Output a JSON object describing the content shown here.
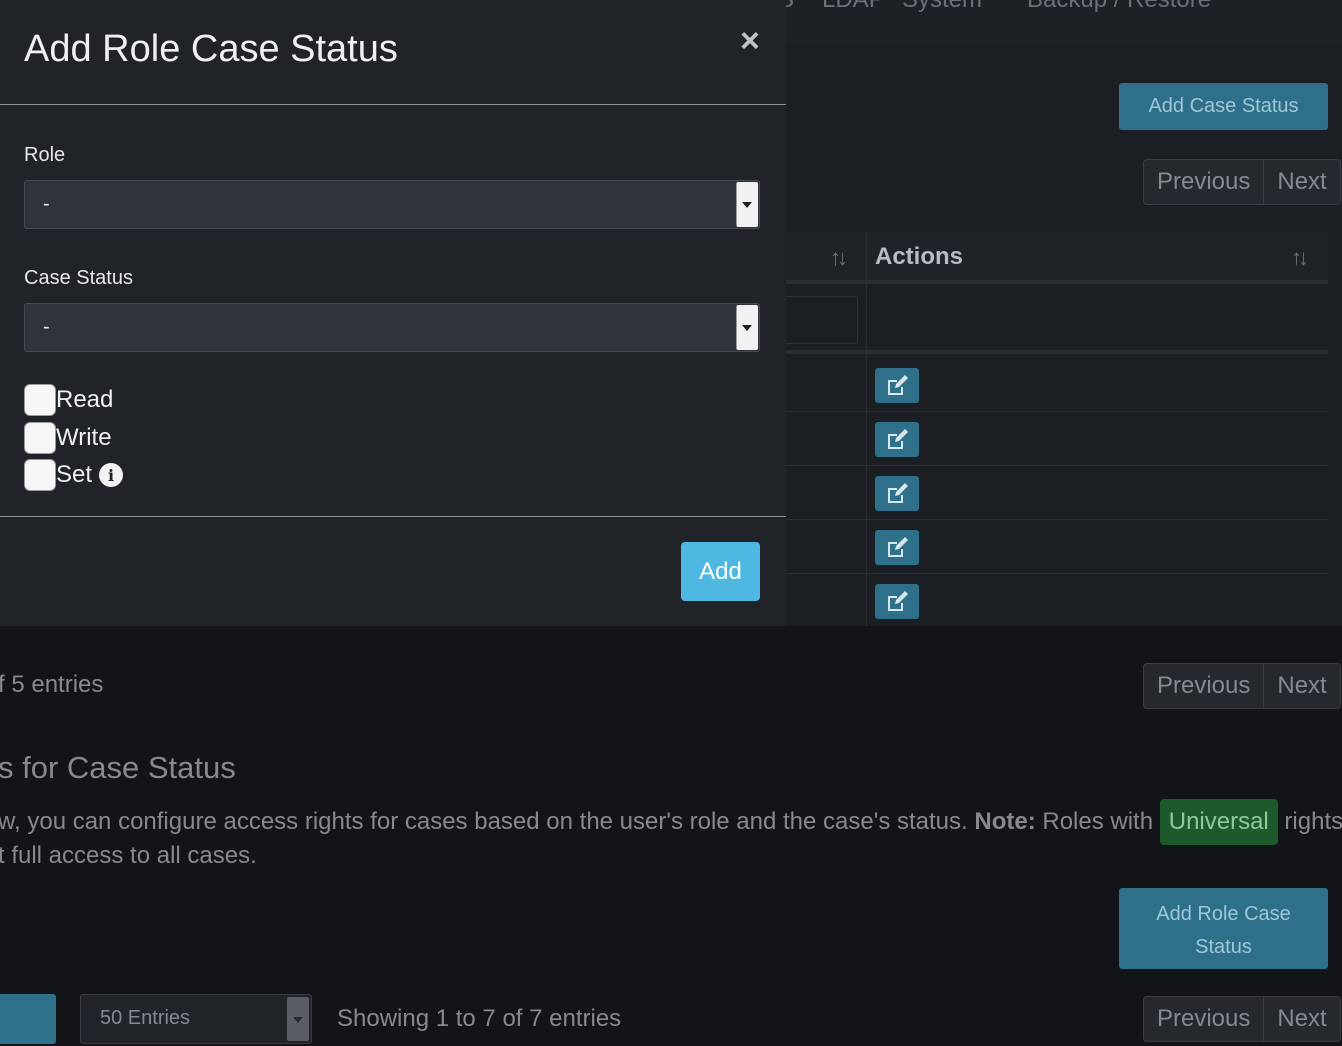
{
  "top_nav": {
    "items": [
      "S",
      "LDAP",
      "System",
      "Backup / Restore"
    ]
  },
  "case_status_section": {
    "add_button": "Add Case Status",
    "pager_top": {
      "previous": "Previous",
      "next": "Next"
    },
    "table": {
      "actions_header": "Actions",
      "row_count": 5
    },
    "footer_info": "f 5 entries",
    "pager_bottom": {
      "previous": "Previous",
      "next": "Next"
    }
  },
  "role_case_status_section": {
    "heading": "s for Case Status",
    "description_line1_pre": "w, you can configure access rights for cases based on the user's role and the case's status. ",
    "note_label": "Note:",
    "description_line1_mid": " Roles with ",
    "universal_badge": "Universal",
    "description_line1_post": " rights",
    "description_line2": "t full access to all cases.",
    "add_button": "Add Role Case Status",
    "entries_select": "50 Entries",
    "showing_info": "Showing 1 to 7 of 7 entries",
    "pager": {
      "previous": "Previous",
      "next": "Next"
    }
  },
  "modal": {
    "title": "Add Role Case Status",
    "close_symbol": "×",
    "role_label": "Role",
    "role_value": "-",
    "case_status_label": "Case Status",
    "case_status_value": "-",
    "checkboxes": [
      {
        "label": "Read",
        "checked": false
      },
      {
        "label": "Write",
        "checked": false
      },
      {
        "label": "Set",
        "checked": false
      }
    ],
    "info_symbol": "i",
    "add_button": "Add"
  },
  "colors": {
    "background": "#131417",
    "panel": "#1b1e22",
    "modal": "#202327",
    "button_blue": "#2e6f8a",
    "add_button": "#4eb8e2",
    "universal_badge": "#1c5a2c"
  }
}
